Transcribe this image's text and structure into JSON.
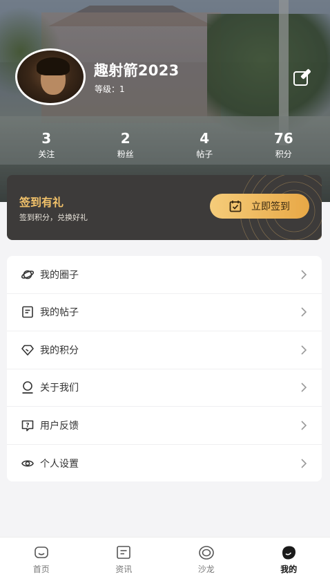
{
  "profile": {
    "username": "趣射箭2023",
    "level": "等级：1"
  },
  "stats": [
    {
      "value": "3",
      "label": "关注"
    },
    {
      "value": "2",
      "label": "粉丝"
    },
    {
      "value": "4",
      "label": "帖子"
    },
    {
      "value": "76",
      "label": "积分"
    }
  ],
  "signin": {
    "title": "签到有礼",
    "subtitle": "签到积分，兑换好礼",
    "button": "立即签到"
  },
  "menu": [
    {
      "label": "我的圈子",
      "icon": "planet-icon"
    },
    {
      "label": "我的帖子",
      "icon": "document-icon"
    },
    {
      "label": "我的积分",
      "icon": "diamond-icon"
    },
    {
      "label": "关于我们",
      "icon": "user-icon"
    },
    {
      "label": "用户反馈",
      "icon": "feedback-icon"
    },
    {
      "label": "个人设置",
      "icon": "eye-settings-icon"
    }
  ],
  "tabbar": [
    {
      "label": "首页",
      "icon": "home-icon"
    },
    {
      "label": "资讯",
      "icon": "news-icon"
    },
    {
      "label": "沙龙",
      "icon": "salon-icon"
    },
    {
      "label": "我的",
      "icon": "mine-icon",
      "active": true
    }
  ],
  "colors": {
    "accent_gold": "#f2c26a",
    "card_dark": "#3d3b3a",
    "button_gradient_start": "#f5cc7a",
    "button_gradient_end": "#e8a846"
  }
}
